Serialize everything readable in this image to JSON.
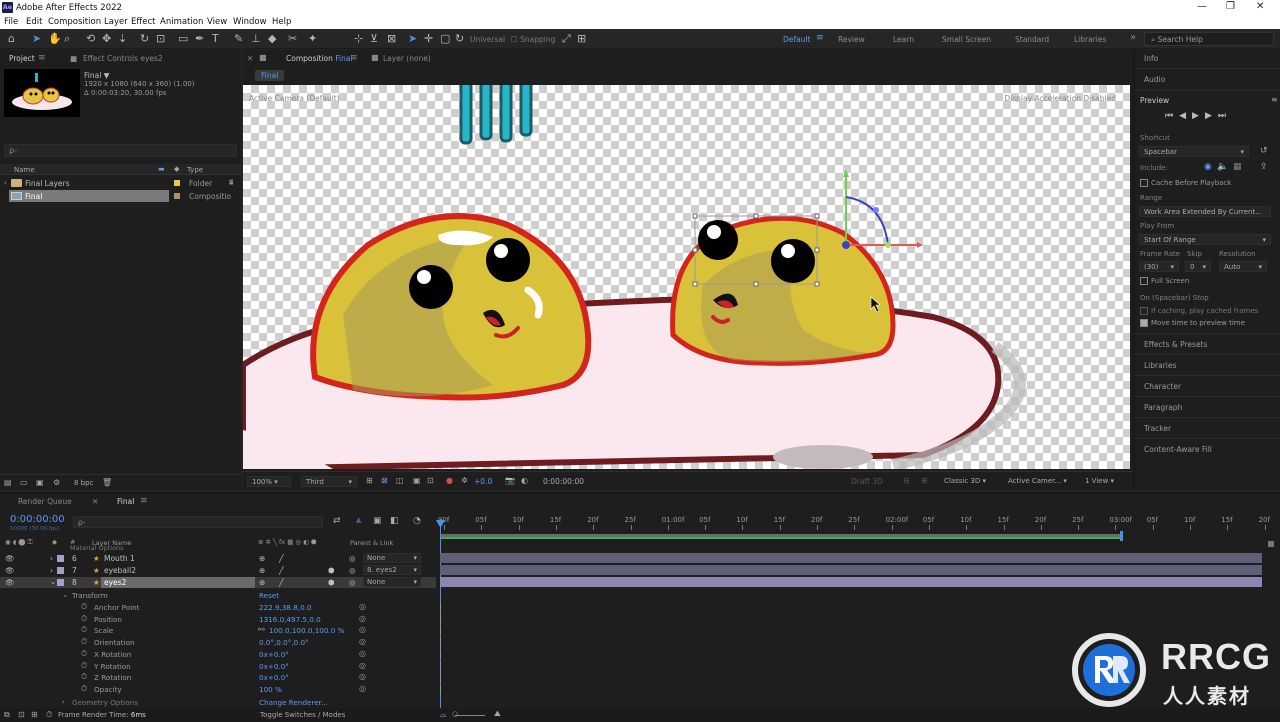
{
  "app": {
    "title": "Adobe After Effects 2022",
    "logo": "Ae"
  },
  "menu": [
    "File",
    "Edit",
    "Composition",
    "Layer",
    "Effect",
    "Animation",
    "View",
    "Window",
    "Help"
  ],
  "toolbar": {
    "universal": "Universal",
    "snapping": "Snapping",
    "workspaces": [
      "Default",
      "Review",
      "Learn",
      "Small Screen",
      "Standard",
      "Libraries"
    ],
    "active_workspace": "Default",
    "search_placeholder": "Search Help"
  },
  "project": {
    "tab_project": "Project",
    "tab_effect_controls": "Effect Controls eyes2",
    "comp_name": "Final ▼",
    "comp_res": "1920 x 1080 (640 x 360) (1.00)",
    "comp_duration": "Δ 0:00:03:20, 30.00 fps",
    "search_placeholder": "ρ-",
    "col_name": "Name",
    "col_type": "Type",
    "items": [
      {
        "name": "Final Layers",
        "type": "Folder"
      },
      {
        "name": "Final",
        "type": "Compositio"
      }
    ],
    "bpc": "8 bpc"
  },
  "composition": {
    "tab_label": "Composition",
    "tab_name": "Final",
    "layer_tab": "Layer (none)",
    "flow_name": "Final",
    "camera_label": "Active Camera (Default)",
    "renderer_label": "Display Acceleration Disabled",
    "zoom": "100%",
    "resolution": "Third",
    "exposure": "+0.0",
    "timecode": "0:00:00:00",
    "draft3d": "Draft 3D",
    "renderer": "Classic 3D",
    "camera": "Active Camer...",
    "views": "1 View"
  },
  "right": {
    "info": "Info",
    "audio": "Audio",
    "preview": "Preview",
    "shortcut_label": "Shortcut",
    "shortcut": "Spacebar",
    "include_label": "Include:",
    "cache_before": "Cache Before Playback",
    "range_label": "Range",
    "range": "Work Area Extended By Current...",
    "play_from_label": "Play From",
    "play_from": "Start Of Range",
    "frame_rate_label": "Frame Rate",
    "skip_label": "Skip",
    "resolution_label": "Resolution",
    "frame_rate": "(30)",
    "skip": "0",
    "resolution": "Auto",
    "full_screen": "Full Screen",
    "stop_label": "On (Spacebar) Stop",
    "if_caching": "If caching, play cached frames",
    "move_time": "Move time to preview time",
    "panels": [
      "Effects & Presets",
      "Libraries",
      "Character",
      "Paragraph",
      "Tracker",
      "Content-Aware Fill"
    ]
  },
  "timeline": {
    "render_queue": "Render Queue",
    "tab_name": "Final",
    "timecode": "0:00:00:00",
    "frame_sub": "00000 (30.00 fps)",
    "col_layer": "Layer Name",
    "col_parent": "Parent & Link",
    "ticks": [
      "00f",
      "05f",
      "10f",
      "15f",
      "20f",
      "25f",
      "01:00f",
      "05f",
      "10f",
      "15f",
      "20f",
      "25f",
      "02:00f",
      "05f",
      "10f",
      "15f",
      "20f",
      "25f",
      "03:00f",
      "05f",
      "10f",
      "15f",
      "20f"
    ],
    "cut_row": "Material Options",
    "layers": [
      {
        "num": "6",
        "name": "Mouth 1",
        "parent": "None"
      },
      {
        "num": "7",
        "name": "eyeball2",
        "parent": "8. eyes2"
      },
      {
        "num": "8",
        "name": "eyes2",
        "parent": "None"
      }
    ],
    "transform_label": "Transform",
    "reset": "Reset",
    "props": [
      {
        "name": "Anchor Point",
        "value": "222.9,38.8,0.0"
      },
      {
        "name": "Position",
        "value": "1316.0,497.5,0.0"
      },
      {
        "name": "Scale",
        "value": "100.0,100.0,100.0 %"
      },
      {
        "name": "Orientation",
        "value": "0.0°,0.0°,0.0°"
      },
      {
        "name": "X Rotation",
        "value": "0x+0.0°"
      },
      {
        "name": "Y Rotation",
        "value": "0x+0.0°"
      },
      {
        "name": "Z Rotation",
        "value": "0x+0.0°"
      },
      {
        "name": "Opacity",
        "value": "100 %"
      }
    ],
    "geometry": "Geometry Options",
    "change_renderer": "Change Renderer...",
    "frame_render_label": "Frame Render Time:",
    "frame_render_value": "6ms",
    "toggle": "Toggle Switches / Modes"
  },
  "watermark": {
    "brand": "RRCG",
    "sub": "人人素材"
  }
}
